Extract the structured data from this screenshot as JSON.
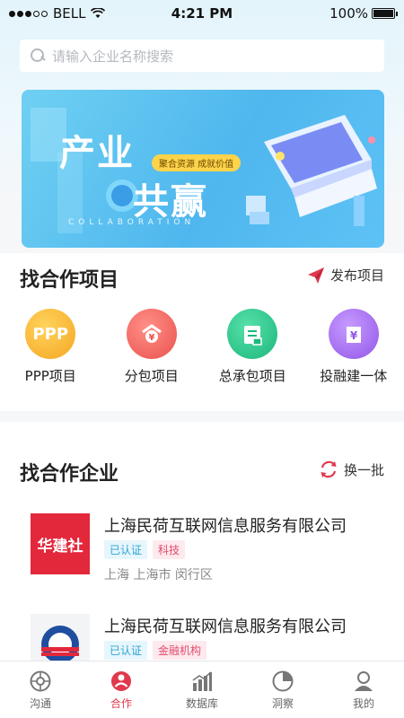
{
  "status": {
    "carrier": "BELL",
    "time": "4:21 PM",
    "battery": "100%"
  },
  "search": {
    "placeholder": "请输入企业名称搜索"
  },
  "banner": {
    "title_line1": "产业",
    "title_line2": "共赢",
    "tagline": "聚合资源 成就价值",
    "subtitle": "COLLABORATION"
  },
  "projects": {
    "title": "找合作项目",
    "publish_label": "发布项目",
    "categories": [
      {
        "label": "PPP项目",
        "icon": "ppp-icon",
        "icon_text": "PPP",
        "color": "#f7b62d"
      },
      {
        "label": "分包项目",
        "icon": "subcontract-icon",
        "icon_text": "",
        "color": "#f06a63"
      },
      {
        "label": "总承包项目",
        "icon": "general-contract-icon",
        "icon_text": "",
        "color": "#2ec88f"
      },
      {
        "label": "投融建一体",
        "icon": "invest-build-icon",
        "icon_text": "",
        "color": "#a66cf0"
      }
    ]
  },
  "companies": {
    "title": "找合作企业",
    "refresh_label": "换一批",
    "items": [
      {
        "name": "上海民荷互联网信息服务有限公司",
        "logo_text": "华建社",
        "logo_color": "#e3283b",
        "tags": [
          "已认证",
          "科技"
        ],
        "location": "上海 上海市 闵行区"
      },
      {
        "name": "上海民荷互联网信息服务有限公司",
        "logo_text": "",
        "logo_color": "#1f4ea1",
        "tags": [
          "已认证",
          "金融机构"
        ],
        "location": ""
      }
    ]
  },
  "tabs": [
    {
      "label": "沟通",
      "icon": "chat-icon",
      "active": false
    },
    {
      "label": "合作",
      "icon": "cooperate-icon",
      "active": true
    },
    {
      "label": "数据库",
      "icon": "database-icon",
      "active": false
    },
    {
      "label": "洞察",
      "icon": "insight-icon",
      "active": false
    },
    {
      "label": "我的",
      "icon": "profile-icon",
      "active": false
    }
  ],
  "colors": {
    "accent": "#e0384d",
    "brand_blue": "#4fb7ee"
  }
}
